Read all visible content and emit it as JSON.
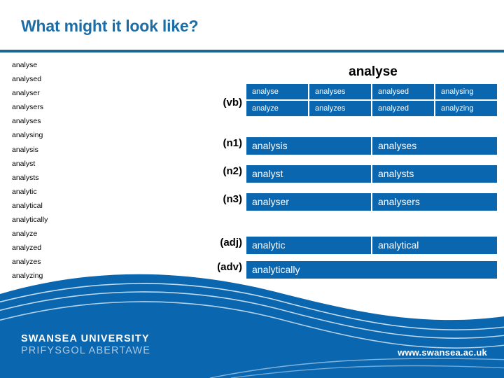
{
  "slide": {
    "title": "What might it look like?"
  },
  "word_list": {
    "items": [
      "analyse",
      "analysed",
      "analyser",
      "analysers",
      "analyses",
      "analysing",
      "analysis",
      "analyst",
      "analysts",
      "analytic",
      "analytical",
      "analytically",
      "analyze",
      "analyzed",
      "analyzes",
      "analyzing"
    ]
  },
  "paradigm": {
    "heading": "analyse",
    "rows": [
      {
        "label": "(vb)",
        "lines": [
          [
            "analyse",
            "analyses",
            "analysed",
            "analysing"
          ],
          [
            "analyze",
            "analyzes",
            "analyzed",
            "analyzing"
          ]
        ]
      },
      {
        "label": "(n1)",
        "cells": [
          "analysis",
          "analyses"
        ]
      },
      {
        "label": "(n2)",
        "cells": [
          "analyst",
          "analysts"
        ]
      },
      {
        "label": "(n3)",
        "cells": [
          "analyser",
          "analysers"
        ]
      },
      {
        "label": "(adj)",
        "cells": [
          "analytic",
          "analytical"
        ]
      },
      {
        "label": "(adv)",
        "cells": [
          "analytically"
        ]
      }
    ]
  },
  "footer": {
    "brand_en": "SWANSEA UNIVERSITY",
    "brand_cy": "PRIFYSGOL ABERTAWE",
    "url": "www.swansea.ac.uk"
  },
  "colors": {
    "accent_blue": "#0B66B0",
    "title_blue": "#1B6DA8",
    "rule_blue": "#1B6694",
    "brand_cy_blue": "#A8C9E4"
  }
}
